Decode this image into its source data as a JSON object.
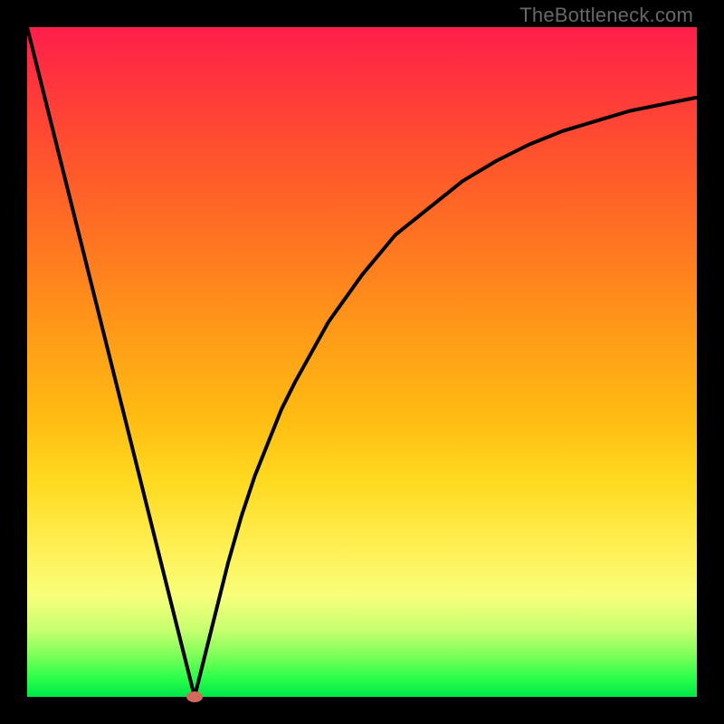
{
  "watermark": "TheBottleneck.com",
  "chart_data": {
    "type": "line",
    "title": "",
    "xlabel": "",
    "ylabel": "",
    "xlim": [
      0,
      100
    ],
    "ylim": [
      0,
      100
    ],
    "grid": false,
    "legend": false,
    "gradient_background": {
      "top_color": "#ff1e4b",
      "bottom_color": "#00e84a",
      "description": "red at top through orange and yellow to green at bottom"
    },
    "series": [
      {
        "name": "bottleneck-curve",
        "color": "#000000",
        "x": [
          0,
          5,
          10,
          15,
          20,
          22,
          24,
          25,
          26,
          28,
          30,
          32,
          34,
          36,
          38,
          40,
          45,
          50,
          55,
          60,
          65,
          70,
          75,
          80,
          85,
          90,
          95,
          100
        ],
        "values": [
          100,
          80,
          60,
          40,
          20,
          12,
          4,
          0,
          4,
          12,
          20,
          27,
          33,
          38,
          43,
          47,
          56,
          63,
          69,
          73,
          77,
          80,
          82.5,
          84.5,
          86,
          87.5,
          88.5,
          89.5
        ]
      }
    ],
    "marker": {
      "name": "min-point",
      "x": 25,
      "y": 0,
      "color": "#d26a5c"
    }
  }
}
